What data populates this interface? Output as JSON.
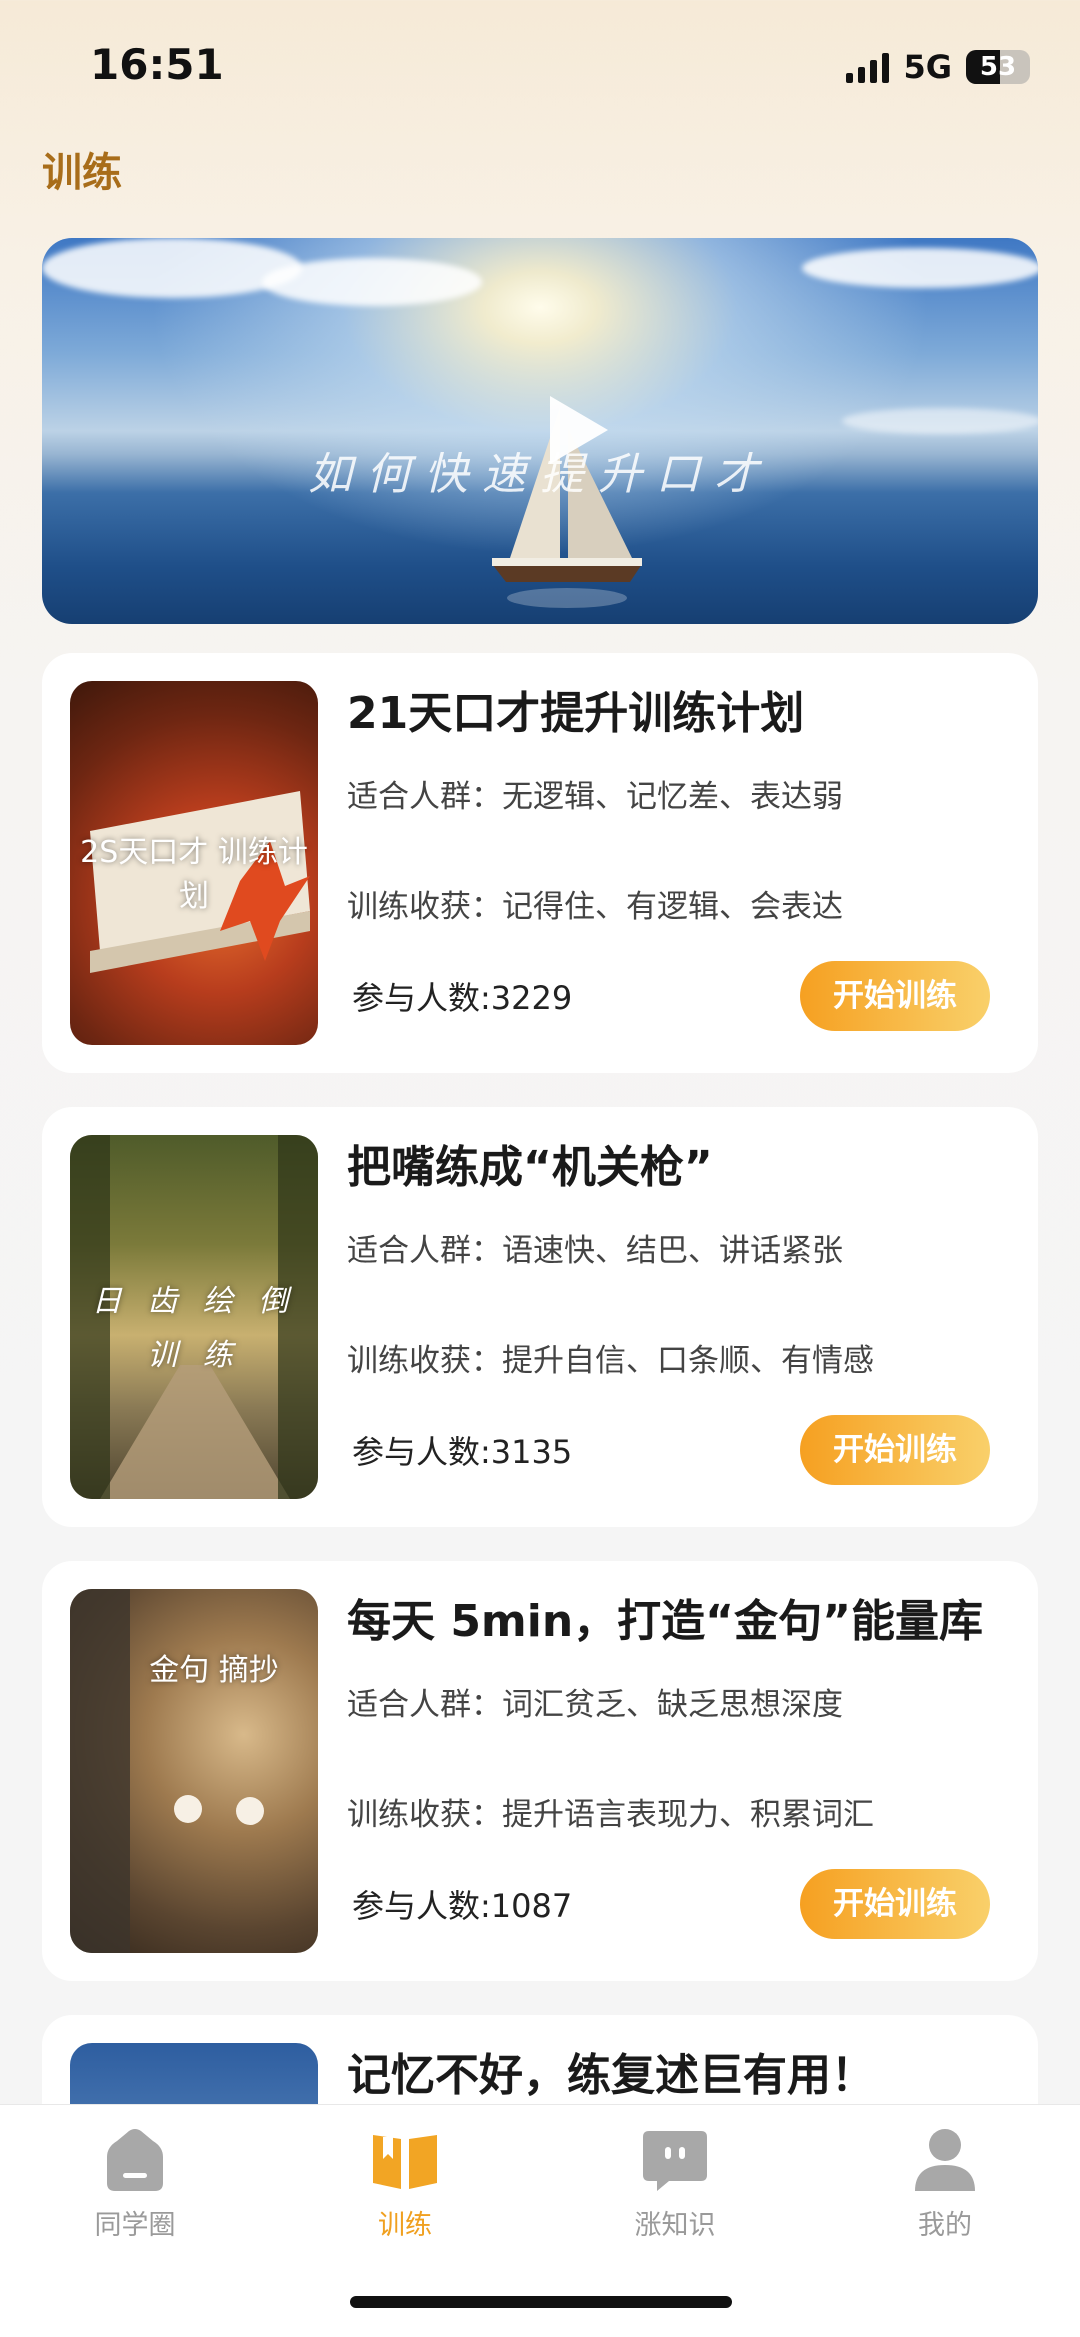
{
  "status": {
    "time": "16:51",
    "network": "5G",
    "battery": "53",
    "battery_level": 0.53
  },
  "header": {
    "title": "训练"
  },
  "banner": {
    "text": "如何快速提升口才"
  },
  "courses": [
    {
      "title": "21天口才提升训练计划",
      "audience": "适合人群：无逻辑、记忆差、表达弱",
      "gain": "训练收获：记得住、有逻辑、会表达",
      "participants": "参与人数:3229",
      "button": "开始训练",
      "thumb_text": "2S天口才 训练计划"
    },
    {
      "title": "把嘴练成“机关枪”",
      "audience": "适合人群：语速快、结巴、讲话紧张",
      "gain": "训练收获：提升自信、口条顺、有情感",
      "participants": "参与人数:3135",
      "button": "开始训练",
      "thumb_text": "日 齿 绘 倒 训 练"
    },
    {
      "title": "每天 5min，打造“金句”能量库",
      "audience": "适合人群：词汇贫乏、缺乏思想深度",
      "gain": "训练收获：提升语言表现力、积累词汇",
      "participants": "参与人数:1087",
      "button": "开始训练",
      "thumb_text": "金句 摘抄"
    },
    {
      "title": "记忆不好，练复述巨有用！"
    }
  ],
  "tabs": [
    {
      "label": "同学圈",
      "icon": "house-icon",
      "active": false
    },
    {
      "label": "训练",
      "icon": "book-icon",
      "active": true
    },
    {
      "label": "涨知识",
      "icon": "chat-bubble-icon",
      "active": false
    },
    {
      "label": "我的",
      "icon": "person-icon",
      "active": false
    }
  ],
  "colors": {
    "accent": "#F0A020",
    "title_brown": "#A86D1A",
    "inactive": "#9A9A9A"
  }
}
